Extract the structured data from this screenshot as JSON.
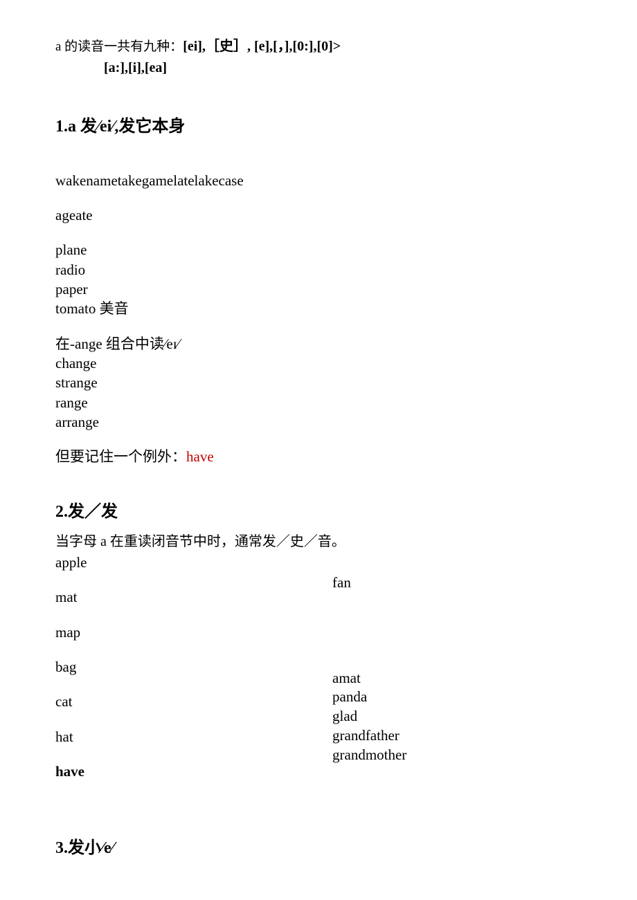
{
  "intro": {
    "prefix": "a 的读音一共有九种：",
    "list1": "[ei],［史］, [e],[，],[0:],[0]>",
    "list2": "[a:],[i],[ea]"
  },
  "section1": {
    "heading": "1.a 发⁄ei⁄,发它本身",
    "p1": "wakenametakegamelatelakecase",
    "p2": "ageate",
    "block1_l1": "plane",
    "block1_l2": "radio",
    "block1_l3": "paper",
    "block1_l4": "tomato 美音",
    "block2_l1": "在-ange 组合中读⁄eɪ⁄",
    "block2_l2": "change",
    "block2_l3": "strange",
    "block2_l4": "range",
    "block2_l5": "arrange",
    "p3_prefix": "但要记住一个例外：",
    "p3_red": "have"
  },
  "section2": {
    "heading": "2.发／发",
    "intro": "当字母 a 在重读闭音节中时，通常发／史／音。",
    "left": {
      "w1": "apple",
      "w2": "mat",
      "w3": "map",
      "w4": "bag",
      "w5": "cat",
      "w6": "hat",
      "w7": "have"
    },
    "right": {
      "w1": "fan",
      "w2": "amat",
      "w3": "panda",
      "w4": "glad",
      "w5": "grandfather",
      "w6": "grandmother"
    }
  },
  "section3": {
    "heading": "3.发小⁄e⁄"
  }
}
